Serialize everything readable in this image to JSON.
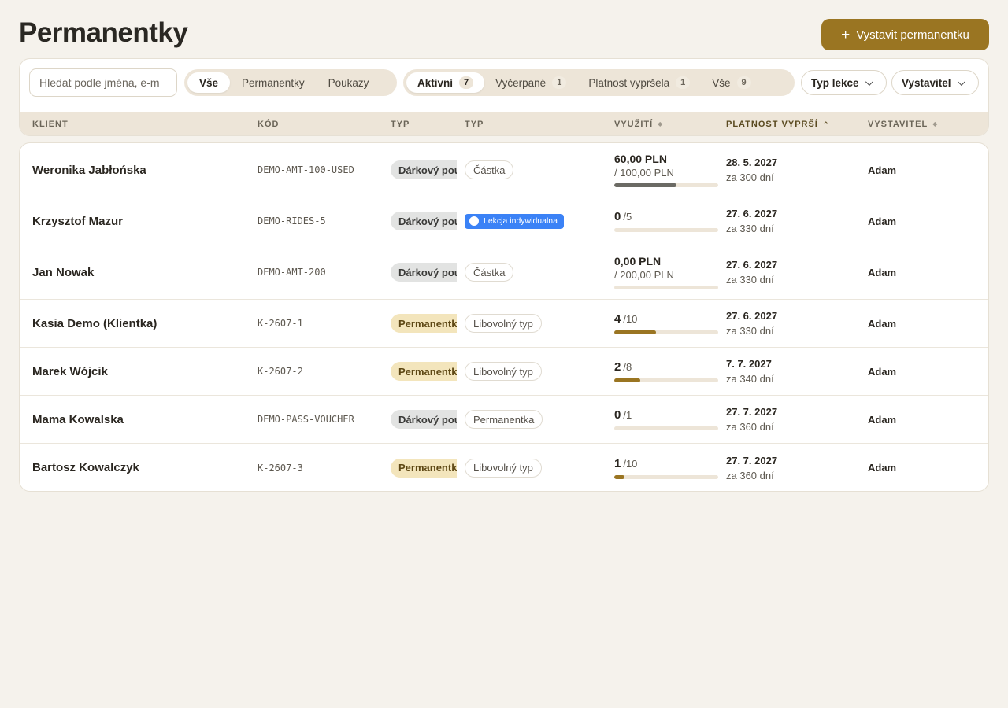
{
  "page": {
    "title": "Permanentky",
    "new_button": {
      "plus": "+",
      "label": "Vystavit permanentku"
    }
  },
  "filters": {
    "search_placeholder": "Hledat podle jména, e-m",
    "kind_tabs": [
      {
        "label": "Vše",
        "active": true
      },
      {
        "label": "Permanentky",
        "active": false
      },
      {
        "label": "Poukazy",
        "active": false
      }
    ],
    "status_tabs": [
      {
        "label": "Aktivní",
        "count": "7",
        "active": true
      },
      {
        "label": "Vyčerpané",
        "count": "1",
        "active": false
      },
      {
        "label": "Platnost vypršela",
        "count": "1",
        "active": false
      },
      {
        "label": "Vše",
        "count": "9",
        "active": false
      }
    ],
    "lesson_type_dropdown": "Typ lekce",
    "issuer_dropdown": "Vystavitel"
  },
  "table": {
    "columns": {
      "client": "KLIENT",
      "code": "KÓD",
      "type": "TYP",
      "subtype": "TYP",
      "usage": "VYUŽITÍ",
      "validity": "PLATNOST VYPRŠÍ",
      "issuer": "VYSTAVITEL"
    },
    "rows": [
      {
        "client": "Weronika Jabłońska",
        "code": "DEMO-AMT-100-USED",
        "type": "Dárkový poukaz",
        "type_kind": "gift",
        "subtype": "Částka",
        "usage_kind": "amount",
        "used": "60,00 PLN",
        "total": "/ 100,00 PLN",
        "progress": 0.6,
        "bar_color": "#6b6a64",
        "date": "28. 5. 2027",
        "in": "za 300 dní",
        "issuer": "Adam"
      },
      {
        "client": "Krzysztof Mazur",
        "code": "DEMO-RIDES-5",
        "type": "Dárkový poukaz",
        "type_kind": "gift",
        "subtype": "Lekcja indywidualna",
        "subtype_kind": "blue",
        "usage_kind": "count",
        "used": "0",
        "total": "/5",
        "progress": 0,
        "bar_color": "#9a7522",
        "date": "27. 6. 2027",
        "in": "za 330 dní",
        "issuer": "Adam"
      },
      {
        "client": "Jan Nowak",
        "code": "DEMO-AMT-200",
        "type": "Dárkový poukaz",
        "type_kind": "gift",
        "subtype": "Částka",
        "usage_kind": "amount",
        "used": "0,00 PLN",
        "total": "/ 200,00 PLN",
        "progress": 0,
        "bar_color": "#6b6a64",
        "date": "27. 6. 2027",
        "in": "za 330 dní",
        "issuer": "Adam"
      },
      {
        "client": "Kasia Demo (Klientka)",
        "code": "K-2607-1",
        "type": "Permanentka",
        "type_kind": "pass",
        "subtype": "Libovolný typ",
        "usage_kind": "count",
        "used": "4",
        "total": "/10",
        "progress": 0.4,
        "bar_color": "#9a7522",
        "date": "27. 6. 2027",
        "in": "za 330 dní",
        "issuer": "Adam"
      },
      {
        "client": "Marek Wójcik",
        "code": "K-2607-2",
        "type": "Permanentka",
        "type_kind": "pass",
        "subtype": "Libovolný typ",
        "usage_kind": "count",
        "used": "2",
        "total": "/8",
        "progress": 0.25,
        "bar_color": "#9a7522",
        "date": "7. 7. 2027",
        "in": "za 340 dní",
        "issuer": "Adam"
      },
      {
        "client": "Mama Kowalska",
        "code": "DEMO-PASS-VOUCHER",
        "type": "Dárkový poukaz",
        "type_kind": "gift",
        "subtype": "Permanentka",
        "usage_kind": "count",
        "used": "0",
        "total": "/1",
        "progress": 0,
        "bar_color": "#9a7522",
        "date": "27. 7. 2027",
        "in": "za 360 dní",
        "issuer": "Adam"
      },
      {
        "client": "Bartosz Kowalczyk",
        "code": "K-2607-3",
        "type": "Permanentka",
        "type_kind": "pass",
        "subtype": "Libovolný typ",
        "usage_kind": "count",
        "used": "1",
        "total": "/10",
        "progress": 0.1,
        "bar_color": "#9a7522",
        "date": "27. 7. 2027",
        "in": "za 360 dní",
        "issuer": "Adam"
      }
    ]
  }
}
